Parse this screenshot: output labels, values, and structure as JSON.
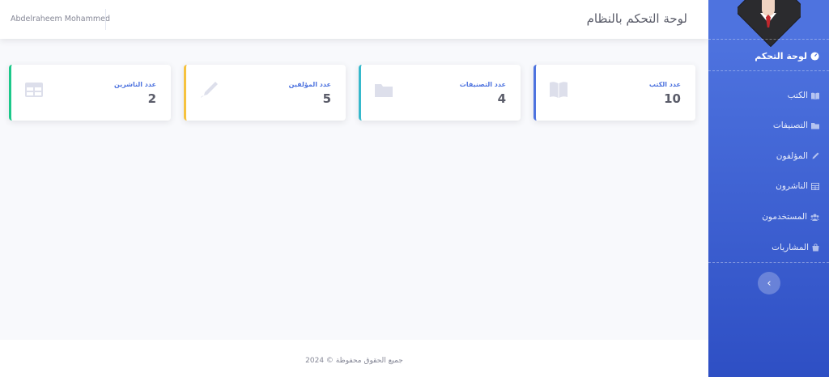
{
  "sidebar": {
    "dashboard_label": "لوحة التحكم",
    "items": [
      {
        "label": "الكتب",
        "icon": "book-icon"
      },
      {
        "label": "التصنيفات",
        "icon": "folder-icon"
      },
      {
        "label": "المؤلفون",
        "icon": "pen-icon"
      },
      {
        "label": "الناشرون",
        "icon": "table-icon"
      },
      {
        "label": "المستخدمون",
        "icon": "users-icon"
      },
      {
        "label": "المشاريات",
        "icon": "basket-icon"
      }
    ],
    "toggle_label": "›"
  },
  "topbar": {
    "title": "لوحة التحكم بالنظام",
    "user_name": "Abdelraheem Mohammed"
  },
  "cards": [
    {
      "label": "عدد الكتب",
      "value": "10",
      "icon": "book-open-icon",
      "color": "#4e73df"
    },
    {
      "label": "عدد التصنيفات",
      "value": "4",
      "icon": "folder-icon",
      "color": "#36b9cc"
    },
    {
      "label": "عدد المؤلفين",
      "value": "5",
      "icon": "pen-icon",
      "color": "#f6c23e"
    },
    {
      "label": "عدد الناشرين",
      "value": "2",
      "icon": "table-icon",
      "color": "#1cc88a"
    }
  ],
  "footer": {
    "text": "جميع الحقوق محفوظة © 2024"
  }
}
